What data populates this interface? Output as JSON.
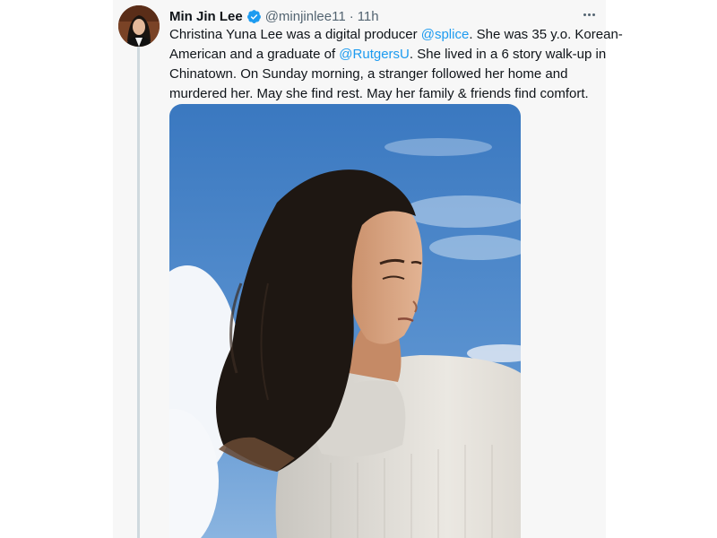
{
  "tweet": {
    "author": {
      "display_name": "Min Jin Lee",
      "handle": "@minjinlee11",
      "verified": true
    },
    "separator": "·",
    "timestamp": "11h",
    "text_lines": [
      {
        "parts": [
          {
            "type": "text",
            "value": "Christina Yuna Lee was a digital producer "
          },
          {
            "type": "mention",
            "value": "@splice"
          },
          {
            "type": "text",
            "value": ". She was 35 y.o. Korean-"
          }
        ]
      },
      {
        "parts": [
          {
            "type": "text",
            "value": "American and a graduate of "
          },
          {
            "type": "mention",
            "value": "@RutgersU"
          },
          {
            "type": "text",
            "value": ". She lived in a 6 story walk-up in"
          }
        ]
      },
      {
        "parts": [
          {
            "type": "text",
            "value": "Chinatown. On Sunday morning, a stranger followed her home and"
          }
        ]
      },
      {
        "parts": [
          {
            "type": "text",
            "value": "murdered her. May she find rest. May her family & friends find comfort."
          }
        ]
      }
    ],
    "icons": {
      "verified": "verified-badge-icon",
      "more": "more-options-icon"
    },
    "colors": {
      "link": "#1d9bf0",
      "verified": "#1d9bf0",
      "secondary_text": "#536471",
      "primary_text": "#0f1419"
    }
  }
}
